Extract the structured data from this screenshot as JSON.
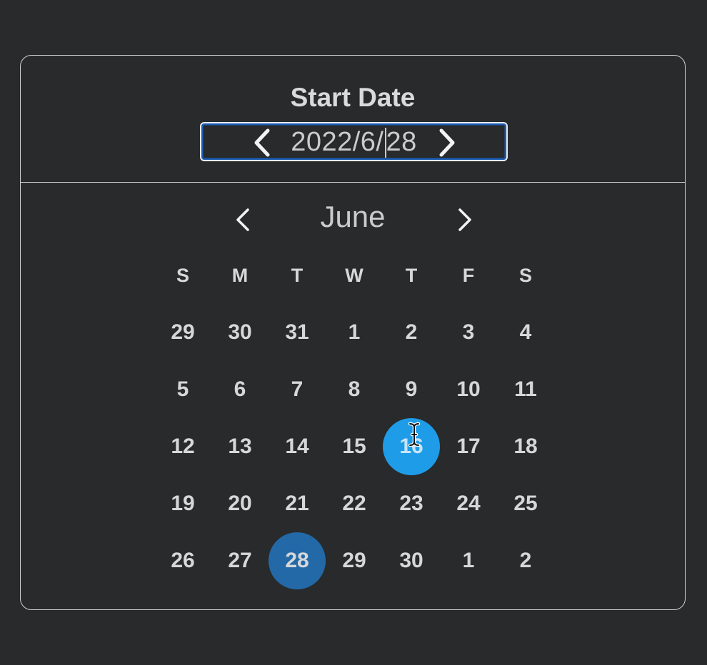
{
  "header": {
    "title": "Start Date",
    "date_value_before_caret": "2022/6/",
    "date_value_after_caret": "28"
  },
  "calendar": {
    "month": "June",
    "weekdays": [
      "S",
      "M",
      "T",
      "W",
      "T",
      "F",
      "S"
    ],
    "weeks": [
      [
        "29",
        "30",
        "31",
        "1",
        "2",
        "3",
        "4"
      ],
      [
        "5",
        "6",
        "7",
        "8",
        "9",
        "10",
        "11"
      ],
      [
        "12",
        "13",
        "14",
        "15",
        "16",
        "17",
        "18"
      ],
      [
        "19",
        "20",
        "21",
        "22",
        "23",
        "24",
        "25"
      ],
      [
        "26",
        "27",
        "28",
        "29",
        "30",
        "1",
        "2"
      ]
    ],
    "selected_day": "28",
    "hovered_day": "16"
  },
  "colors": {
    "background": "#282a2b",
    "hover_highlight": "#1f9ce8",
    "selected_highlight": "#2369a8",
    "field_focus": "#1a5cb6"
  },
  "icons": {
    "prev": "chevron-left-icon",
    "next": "chevron-right-icon",
    "cursor": "text-cursor-icon"
  }
}
